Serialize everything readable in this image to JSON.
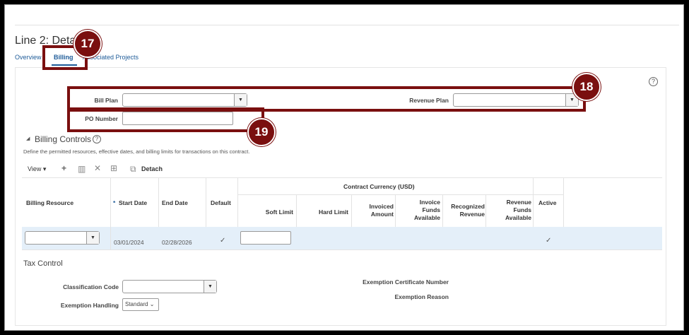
{
  "page": {
    "title": "Line 2: Details"
  },
  "tabs": [
    {
      "label": "Overview"
    },
    {
      "label": "Billing"
    },
    {
      "label": "Associated Projects"
    }
  ],
  "billing_form": {
    "bill_plan_label": "Bill Plan",
    "bill_plan_value": "",
    "revenue_plan_label": "Revenue Plan",
    "revenue_plan_value": "",
    "po_number_label": "PO Number",
    "po_number_value": ""
  },
  "billing_controls": {
    "title": "Billing Controls",
    "description": "Define the permitted resources, effective dates, and billing limits for transactions on this contract.",
    "toolbar": {
      "view_label": "View",
      "detach_label": "Detach"
    },
    "group_header": "Contract Currency (USD)",
    "columns": {
      "billing_resource": "Billing Resource",
      "start_date": "Start Date",
      "end_date": "End Date",
      "default": "Default",
      "soft_limit": "Soft Limit",
      "hard_limit": "Hard Limit",
      "invoiced_amount": "Invoiced Amount",
      "invoice_funds_available": "Invoice Funds Available",
      "recognized_revenue": "Recognized Revenue",
      "revenue_funds_available": "Revenue Funds Available",
      "active": "Active"
    },
    "required_marker": "*",
    "rows": [
      {
        "start_date": "03/01/2024",
        "end_date": "02/28/2026",
        "default": "✓",
        "active": "✓"
      }
    ]
  },
  "tax_control": {
    "title": "Tax Control",
    "classification_code_label": "Classification Code",
    "exemption_handling_label": "Exemption Handling",
    "exemption_handling_value": "Standard",
    "exemption_certificate_label": "Exemption Certificate Number",
    "exemption_reason_label": "Exemption Reason"
  },
  "callouts": [
    {
      "number": "17"
    },
    {
      "number": "18"
    },
    {
      "number": "19"
    }
  ],
  "colors": {
    "callout": "#7a0f0f",
    "link": "#1f5c99",
    "selected_row": "#e4eff9"
  },
  "icons": [
    "help-icon",
    "dropdown-arrow-icon",
    "collapse-triangle-icon",
    "add-icon",
    "delete-icon",
    "cancel-icon",
    "freeze-icon",
    "detach-icon",
    "checkmark-icon"
  ]
}
